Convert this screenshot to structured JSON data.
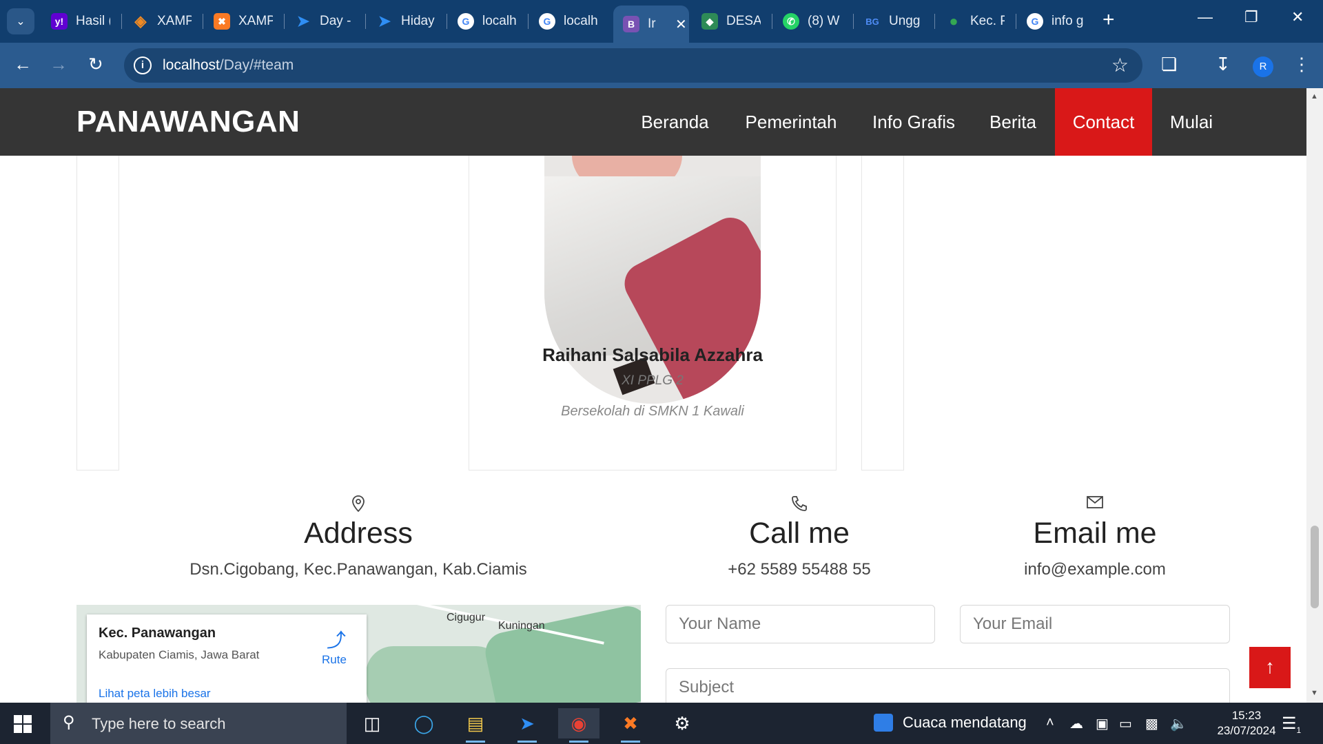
{
  "browser": {
    "tabs": [
      {
        "title": "Hasil (",
        "icon": "yahoo-icon",
        "color": "#6001d2"
      },
      {
        "title": "XAMP",
        "icon": "xampp-diamond-icon",
        "color": "#f08a24"
      },
      {
        "title": "XAMP",
        "icon": "xampp-icon",
        "color": "#fb7a24"
      },
      {
        "title": "Day -",
        "icon": "bird-icon",
        "color": "#2f8ef4"
      },
      {
        "title": "Hiday",
        "icon": "bird-icon",
        "color": "#2f8ef4"
      },
      {
        "title": "localh",
        "icon": "google-icon",
        "color": "#ffffff"
      },
      {
        "title": "localh",
        "icon": "google-icon",
        "color": "#ffffff"
      },
      {
        "title": "Ir",
        "icon": "bootstrap-icon",
        "color": "#7952b3"
      },
      {
        "title": "DESA",
        "icon": "emblem-icon",
        "color": "#2e8b57"
      },
      {
        "title": "(8) W",
        "icon": "whatsapp-icon",
        "color": "#25d366"
      },
      {
        "title": "Ungg",
        "icon": "bg-icon",
        "color": "#1a56db"
      },
      {
        "title": "Kec. P",
        "icon": "maps-pin-icon",
        "color": "#34a853"
      },
      {
        "title": "info g",
        "icon": "google-icon",
        "color": "#ffffff"
      }
    ],
    "url_host": "localhost",
    "url_path": "/Day/#team",
    "profile_initial": "R"
  },
  "site": {
    "logo": "PANAWANGAN",
    "nav": [
      "Beranda",
      "Pemerintah",
      "Info Grafis",
      "Berita",
      "Contact",
      "Mulai"
    ],
    "active_nav": "Contact",
    "accent": "#d91818"
  },
  "team": {
    "name": "Raihani Salsabila Azzahra",
    "class": "XI PPLG 2",
    "description": "Bersekolah di SMKN 1 Kawali"
  },
  "contact": {
    "address_title": "Address",
    "address_value": "Dsn.Cigobang, Kec.Panawangan, Kab.Ciamis",
    "call_title": "Call me",
    "call_value": "+62 5589 55488 55",
    "email_title": "Email me",
    "email_value": "info@example.com",
    "name_placeholder": "Your Name",
    "email_placeholder": "Your Email",
    "subject_placeholder": "Subject"
  },
  "map": {
    "place": "Kec. Panawangan",
    "region": "Kabupaten Ciamis, Jawa Barat",
    "route_label": "Rute",
    "larger_map": "Lihat peta lebih besar",
    "labels": [
      "Cigugur",
      "Kuningan"
    ]
  },
  "taskbar": {
    "search_placeholder": "Type here to search",
    "weather": "Cuaca mendatang",
    "time": "15:23",
    "date": "23/07/2024",
    "notifications": "1"
  }
}
